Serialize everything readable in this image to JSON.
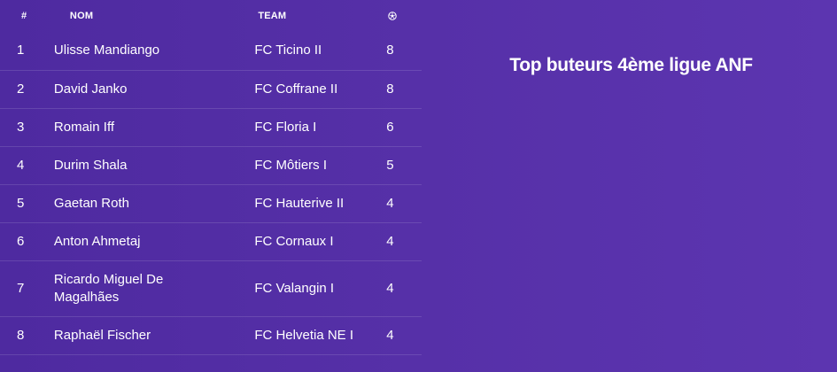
{
  "title": "Top buteurs 4ème ligue ANF",
  "table": {
    "headers": {
      "rank": "#",
      "name": "NOM",
      "team": "TEAM",
      "goals_icon": "soccer-ball-icon"
    },
    "rows": [
      {
        "rank": "1",
        "name": "Ulisse Mandiango",
        "team": "FC Ticino II",
        "goals": "8"
      },
      {
        "rank": "2",
        "name": "David Janko",
        "team": "FC Coffrane II",
        "goals": "8"
      },
      {
        "rank": "3",
        "name": "Romain Iff",
        "team": "FC Floria I",
        "goals": "6"
      },
      {
        "rank": "4",
        "name": "Durim Shala",
        "team": "FC Môtiers I",
        "goals": "5"
      },
      {
        "rank": "5",
        "name": "Gaetan Roth",
        "team": "FC Hauterive II",
        "goals": "4"
      },
      {
        "rank": "6",
        "name": "Anton Ahmetaj",
        "team": "FC Cornaux I",
        "goals": "4"
      },
      {
        "rank": "7",
        "name": "Ricardo Miguel De Magalhães",
        "team": "FC Valangin I",
        "goals": "4"
      },
      {
        "rank": "8",
        "name": "Raphaël Fischer",
        "team": "FC Helvetia NE I",
        "goals": "4"
      }
    ]
  },
  "colors": {
    "background": "#5630a8",
    "text": "#ffffff"
  }
}
